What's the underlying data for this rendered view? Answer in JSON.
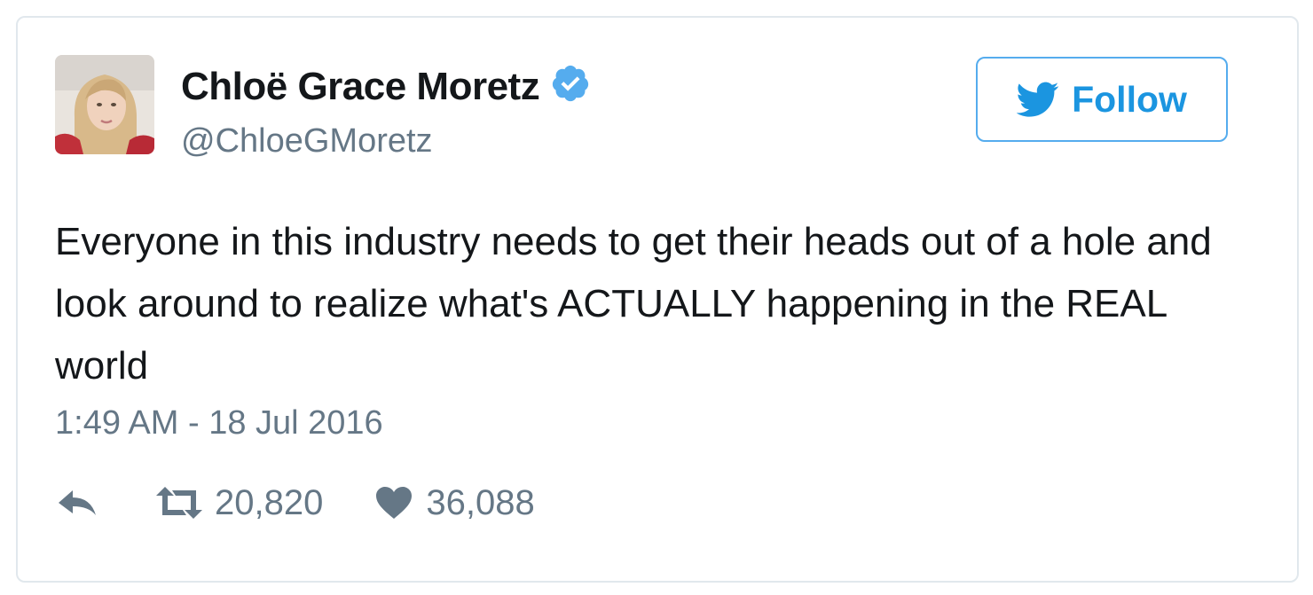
{
  "author": {
    "name": "Chloë Grace Moretz",
    "handle": "@ChloeGMoretz",
    "verified": true
  },
  "follow_button": {
    "label": "Follow",
    "icon": "twitter-bird-icon"
  },
  "tweet": {
    "text": "Everyone in this industry needs to get their heads out of a hole and look around to realize what's ACTUALLY happening in the REAL world",
    "timestamp": "1:49 AM - 18 Jul 2016"
  },
  "actions": {
    "reply": {
      "icon": "reply-icon"
    },
    "retweet": {
      "icon": "retweet-icon",
      "count": "20,820"
    },
    "like": {
      "icon": "heart-icon",
      "count": "36,088"
    }
  },
  "colors": {
    "brand": "#1b95e0",
    "verified": "#55acee",
    "text_primary": "#14171a",
    "text_secondary": "#657786",
    "border": "#e1e8ed"
  }
}
